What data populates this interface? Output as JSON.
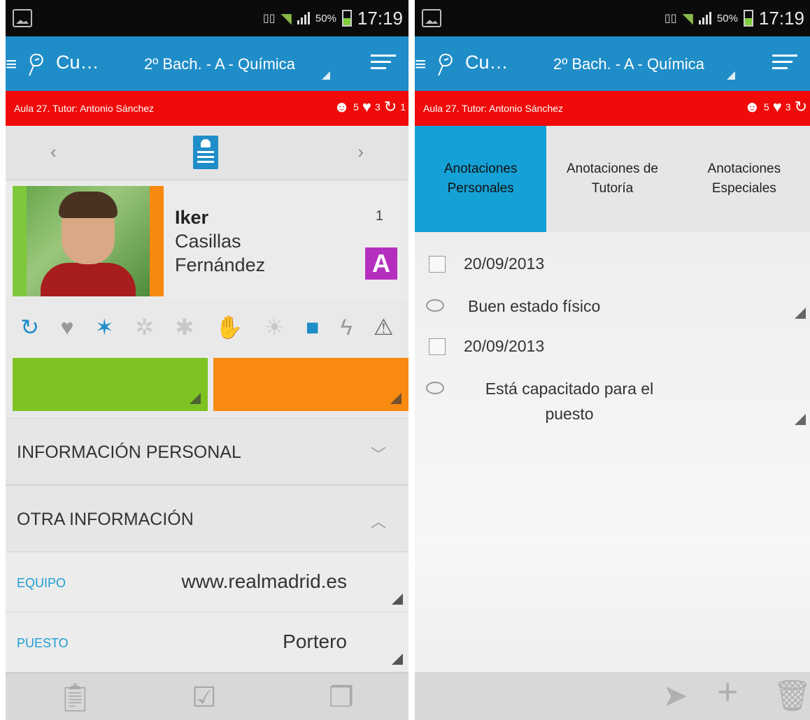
{
  "status_bar": {
    "battery": "50%",
    "time": "17:19"
  },
  "action_bar": {
    "app_title": "Cu…",
    "class_name": "2º Bach. - A - Química"
  },
  "info_bar": {
    "text": "Aula 27. Tutor: Antonio Sánchez",
    "count_students": "5",
    "count_hearts": "3",
    "count_refresh": "1"
  },
  "profile": {
    "first_name": "Iker",
    "last_name_1": "Casillas",
    "last_name_2": "Fernández",
    "roll_number": "1",
    "grade": "A"
  },
  "sections": {
    "personal": "INFORMACIÓN PERSONAL",
    "other": "OTRA INFORMACIÓN"
  },
  "fields": [
    {
      "label": "EQUIPO",
      "value": "www.realmadrid.es"
    },
    {
      "label": "PUESTO",
      "value": "Portero"
    }
  ],
  "tabs": [
    {
      "label": "Anotaciones Personales",
      "active": true
    },
    {
      "label": "Anotaciones de Tutoría",
      "active": false
    },
    {
      "label": "Anotaciones Especiales",
      "active": false
    }
  ],
  "notes": [
    {
      "date": "20/09/2013",
      "text": "Buen estado físico"
    },
    {
      "date": "20/09/2013",
      "text": "Está capacitado para el puesto"
    }
  ],
  "colors": {
    "action_bar": "#1f8dc8",
    "info_bar": "#f00a0a",
    "active_tab": "#14a1d6",
    "green_block": "#7ec322",
    "orange_block": "#f88a12",
    "grade_badge": "#b52fbf",
    "field_label": "#1f9dd3"
  },
  "icons": {
    "behavior_row": [
      "refresh-icon",
      "heart-icon",
      "star-icon",
      "gears-icon",
      "bug-icon",
      "thumbs-up-icon",
      "lightbulb-icon",
      "lock-icon",
      "lightning-icon",
      "warning-icon"
    ],
    "left_bottom": [
      "edit-clipboard-icon",
      "checkbox-icon",
      "copy-icon"
    ],
    "right_bottom": [
      "send-icon",
      "add-icon",
      "trash-icon"
    ]
  }
}
